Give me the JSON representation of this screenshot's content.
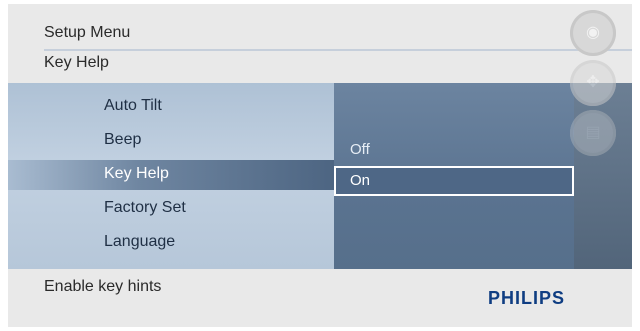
{
  "header": {
    "title": "Setup Menu",
    "subtitle": "Key Help"
  },
  "menu": {
    "items": [
      {
        "label": "Auto Tilt"
      },
      {
        "label": "Beep"
      },
      {
        "label": "Key Help",
        "selected": true
      },
      {
        "label": "Factory Set"
      },
      {
        "label": "Language"
      }
    ]
  },
  "options": {
    "items": [
      {
        "label": "Off"
      },
      {
        "label": "On",
        "selected": true
      }
    ]
  },
  "footer": {
    "hint": "Enable key hints",
    "brand": "PHILIPS"
  },
  "side_controls": [
    {
      "icon": "play-slideshow-icon",
      "glyph": "◉"
    },
    {
      "icon": "navigation-pad-icon",
      "glyph": "✥"
    },
    {
      "icon": "menu-icon",
      "glyph": "▤"
    }
  ],
  "colors": {
    "brand": "#0f3d82",
    "panel": "#5a7390",
    "menu_bg": "#b9cadd",
    "highlight": "#4e6786"
  }
}
